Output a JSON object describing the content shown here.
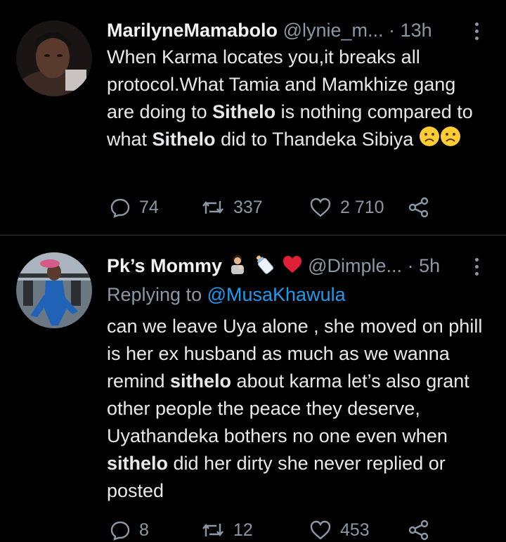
{
  "tweets": [
    {
      "name": "MarilyneMamabolo",
      "handle": "@lynie_m...",
      "sep": "·",
      "time": "13h",
      "text_parts": [
        "When Karma locates you,it breaks all protocol.What Tamia and Mamkhize gang are doing to ",
        "Sithelo",
        " is nothing compared to what ",
        "Sithelo",
        " did to Thandeka Sibiya "
      ],
      "emoji": [
        "frowning-face-icon",
        "frowning-face-icon"
      ],
      "replies": "74",
      "retweets": "337",
      "likes": "2 710"
    },
    {
      "name": "Pk’s Mommy",
      "handle": "@Dimple...",
      "sep": "·",
      "time": "5h",
      "name_emoji": [
        "woman-feeding-baby-icon",
        "baby-bottle-icon",
        "red-heart-icon"
      ],
      "replying_label": "Replying to ",
      "replying_to": "@MusaKhawula",
      "text_parts": [
        "can we leave Uya alone , she moved on phill is her ex husband as much as we wanna remind ",
        "sithelo",
        " about karma let’s also grant other people the peace they deserve, Uyathandeka bothers no one even when ",
        "sithelo",
        " did her dirty she never replied or posted"
      ],
      "replies": "8",
      "retweets": "12",
      "likes": "453"
    }
  ],
  "colors": {
    "accent": "#1d9bf0",
    "muted": "#8b98a5",
    "text": "#e7e9ea",
    "divider": "#2f3336"
  }
}
